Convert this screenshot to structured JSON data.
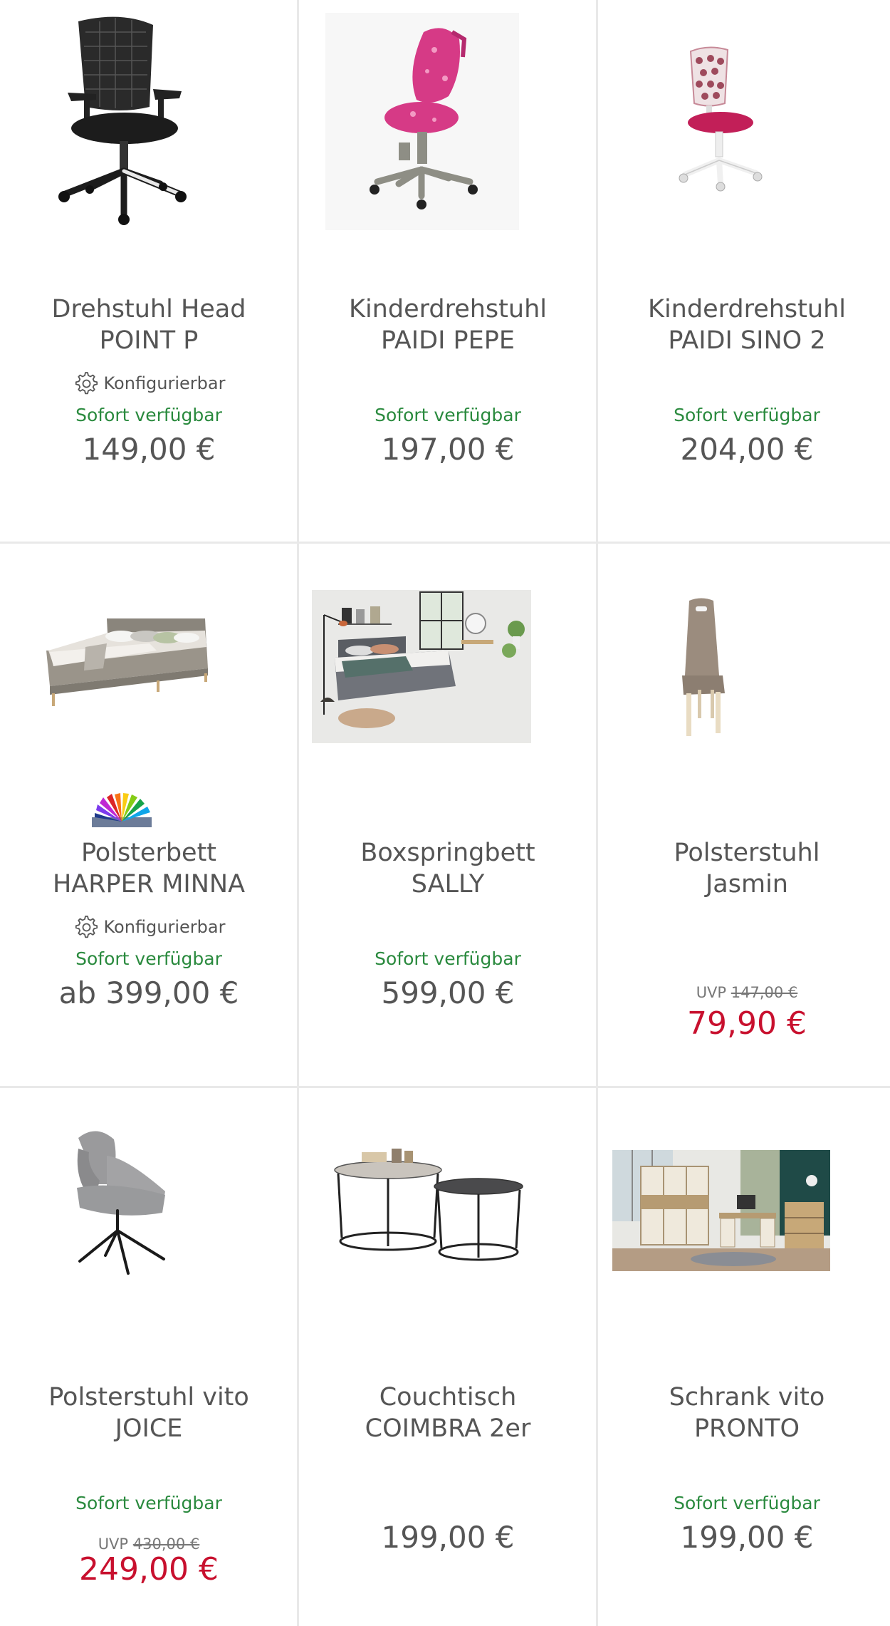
{
  "products": [
    {
      "title_line1": "Drehstuhl Head",
      "title_line2": "POINT P",
      "configurable": "Konfigurierbar",
      "availability": "Sofort verfügbar",
      "price": "149,00 €"
    },
    {
      "title_line1": "Kinderdrehstuhl",
      "title_line2": "PAIDI PEPE",
      "availability": "Sofort verfügbar",
      "price": "197,00 €"
    },
    {
      "title_line1": "Kinderdrehstuhl",
      "title_line2": "PAIDI SINO 2",
      "availability": "Sofort verfügbar",
      "price": "204,00 €"
    },
    {
      "title_line1": "Polsterbett",
      "title_line2": "HARPER MINNA",
      "configurable": "Konfigurierbar",
      "availability": "Sofort verfügbar",
      "price": "ab 399,00 €"
    },
    {
      "title_line1": "Boxspringbett",
      "title_line2": "SALLY",
      "availability": "Sofort verfügbar",
      "price": "599,00 €"
    },
    {
      "title_line1": "Polsterstuhl",
      "title_line2": "Jasmin",
      "uvp_label": "UVP",
      "uvp_price": "147,00 €",
      "sale_price": "79,90 €"
    },
    {
      "title_line1": "Polsterstuhl vito",
      "title_line2": "JOICE",
      "availability": "Sofort verfügbar",
      "uvp_label": "UVP",
      "uvp_price": "430,00 €",
      "sale_price": "249,00 €"
    },
    {
      "title_line1": "Couchtisch",
      "title_line2": "COIMBRA 2er",
      "price": "199,00 €"
    },
    {
      "title_line1": "Schrank vito",
      "title_line2": "PRONTO",
      "availability": "Sofort verfügbar",
      "price": "199,00 €"
    }
  ],
  "colors": {
    "availability_green": "#2a8a3e",
    "sale_red": "#c8102e",
    "text_gray": "#555555",
    "divider": "#e9e9e9"
  }
}
